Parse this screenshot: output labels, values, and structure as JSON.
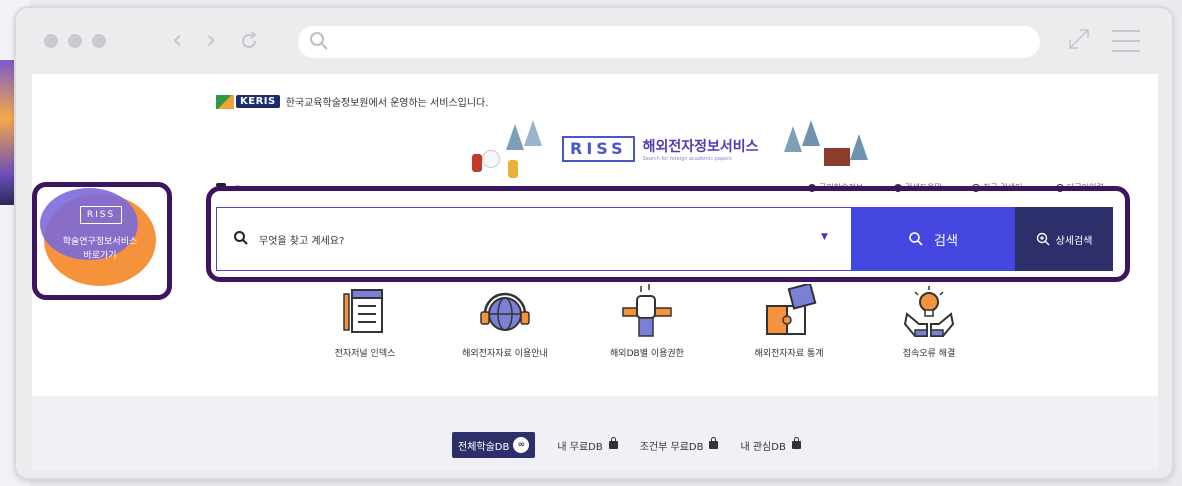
{
  "browser": {
    "address_value": ""
  },
  "header": {
    "keris_logo": "KERIS",
    "keris_text": "한국교육학술정보원에서 운영하는 서비스입니다.",
    "riss_logo": "RISS",
    "riss_title": "해외전자정보서비스",
    "riss_subtitle": "Search for foreign academic papers"
  },
  "quicklinks": [
    {
      "label": "국외학술정보",
      "icon": "info-icon"
    },
    {
      "label": "검색도움말",
      "icon": "help-icon"
    },
    {
      "label": "최근 검색어",
      "icon": "clock-icon"
    },
    {
      "label": "다국어입력",
      "icon": "globe-icon"
    }
  ],
  "search": {
    "placeholder": "무엇을 찾고 계세요?",
    "search_label": "검색",
    "advanced_label": "상세검색"
  },
  "services": [
    {
      "label": "전자저널 인덱스",
      "icon": "journal-index-icon"
    },
    {
      "label": "해외전자자료 이용안내",
      "icon": "globe-headphones-icon"
    },
    {
      "label": "해외DB별 이용권한",
      "icon": "hand-pencil-icon"
    },
    {
      "label": "해외전자자료 통계",
      "icon": "puzzle-icon"
    },
    {
      "label": "접속오류 해결",
      "icon": "lightbulb-hands-icon"
    }
  ],
  "tabs": [
    {
      "label": "전체학술DB",
      "badge": "∞",
      "active": true
    },
    {
      "label": "내 무료DB",
      "active": false
    },
    {
      "label": "조건부 무료DB",
      "active": false
    },
    {
      "label": "내 관심DB",
      "active": false
    }
  ],
  "promo": {
    "logo": "RISS",
    "line1": "학술연구정보서비스",
    "line2": "바로가기"
  },
  "colors": {
    "highlight_outline": "#3c1460",
    "search_button": "#4548e0",
    "advanced_button": "#2d2f6b",
    "brand_purple": "#4a3db8",
    "promo_orange": "#f5933c"
  }
}
